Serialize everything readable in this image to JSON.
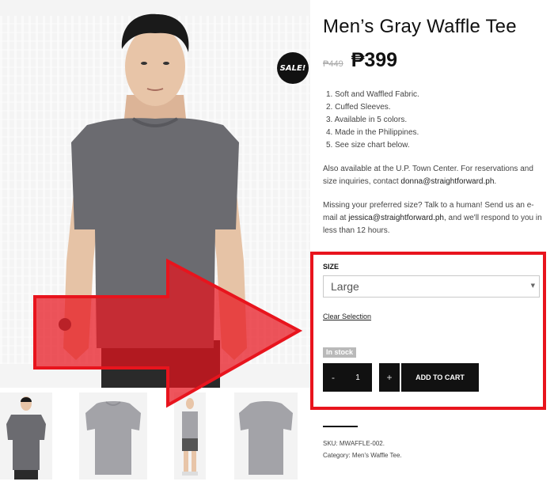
{
  "product": {
    "title": "Men’s Gray Waffle Tee",
    "sale_badge": "SALE!",
    "price_old": "₱449",
    "price_new": "₱399",
    "features": [
      "1. Soft and Waffled Fabric.",
      "2. Cuffed Sleeves.",
      "3. Available in 5 colors.",
      "4. Made in the Philippines.",
      "5. See size chart below."
    ],
    "store_note": {
      "text": "Also available at the U.P. Town Center. For reservations and size inquiries, contact ",
      "email": "donna@straightforward.ph",
      "end": "."
    },
    "size_note": {
      "text": "Missing your preferred size? Talk to a human! Send us an e-mail at ",
      "email": "jessica@straightforward.ph",
      "end": ", and we'll respond to you in less than 12 hours."
    }
  },
  "variations": {
    "size_label": "SIZE",
    "size_selected": "Large",
    "clear_label": "Clear Selection",
    "stock_status": "In stock",
    "qty_minus": "-",
    "qty_value": "1",
    "qty_plus": "+",
    "add_to_cart": "ADD TO CART"
  },
  "meta": {
    "sku": "SKU: MWAFFLE-002.",
    "category": "Category: Men's Waffle Tee."
  },
  "colors": {
    "annotation_red": "#e8141d",
    "shirt_gray": "#6b6b70",
    "button_black": "#111111"
  }
}
